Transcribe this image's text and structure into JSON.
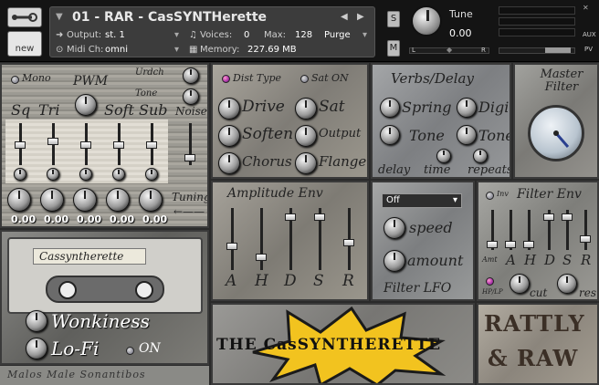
{
  "header": {
    "instrument_name": "01 - RAR - CasSYNTHerette",
    "output_label": "Output:",
    "output_value": "st. 1",
    "voices_label": "Voices:",
    "voices_value": "0",
    "max_label": "Max:",
    "max_value": "128",
    "purge_label": "Purge",
    "midi_label": "Midi Ch:",
    "midi_value": "omni",
    "memory_label": "Memory:",
    "memory_value": "227.69 MB",
    "new_label": "new",
    "solo_label": "S",
    "mute_label": "M",
    "tune_label": "Tune",
    "tune_value": "0.00",
    "pan_left": "L",
    "pan_right": "R",
    "aux_label": "AUX",
    "pv_label": "PV"
  },
  "pwm": {
    "title": "PWM",
    "mono_label": "Mono",
    "tuning_label": "Tuning",
    "urdch_label": "Urdch",
    "tone_label": "Tone",
    "noise_label": "Noise",
    "channels": [
      {
        "label": "Sq",
        "value": "0.00"
      },
      {
        "label": "Tri",
        "value": "0.00"
      },
      {
        "label": "Soft",
        "value": "0.00"
      },
      {
        "label": "Sub",
        "value": "0.00"
      },
      {
        "label": "",
        "value": "0.00"
      }
    ]
  },
  "fx": {
    "dist_type_label": "Dist Type",
    "sat_on_label": "Sat ON",
    "knobs": [
      "Drive",
      "Sat",
      "Soften",
      "Output",
      "Chorus",
      "Flange"
    ]
  },
  "verb": {
    "title": "Verbs/Delay",
    "knobs": [
      "Spring",
      "Digi",
      "Tone",
      "Tone"
    ],
    "bottom": [
      "delay",
      "time",
      "repeats"
    ]
  },
  "master": {
    "title": "Master Filter"
  },
  "amp": {
    "title": "Amplitude Env",
    "stages": [
      "A",
      "H",
      "D",
      "S",
      "R"
    ]
  },
  "lfo": {
    "select_value": "Off",
    "speed_label": "speed",
    "amount_label": "amount",
    "title": "Filter LFO"
  },
  "filterenv": {
    "title": "Filter Env",
    "inv_label": "Inv",
    "amt_label": "Amt",
    "hp_label": "HP/LP",
    "cut_label": "cut",
    "res_label": "res",
    "stages": [
      "A",
      "H",
      "D",
      "S",
      "R"
    ]
  },
  "cassette": {
    "tape_label": "Cassyntherette",
    "wonkiness_label": "Wonkiness",
    "lofi_label": "Lo-Fi",
    "on_label": "ON",
    "credit": "Malos Male Sonantibos"
  },
  "brand": {
    "title": "THE CasSYNTHERETTE",
    "logo_line1": "RATTLY",
    "logo_line2": "& RAW"
  }
}
